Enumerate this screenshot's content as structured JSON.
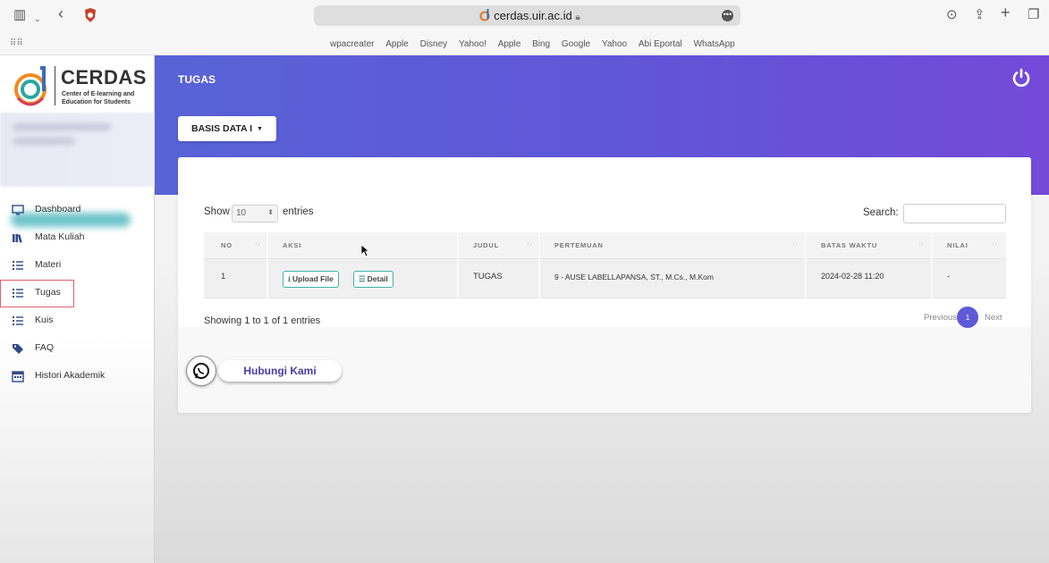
{
  "browser": {
    "url": "cerdas.uir.ac.id",
    "bookmarks": [
      "wpacreater",
      "Apple",
      "Disney",
      "Yahoo!",
      "Apple",
      "Bing",
      "Google",
      "Yahoo",
      "Abi Eportal",
      "WhatsApp"
    ]
  },
  "logo": {
    "title": "CERDAS",
    "subtitle": "Center of E-learning and Education for Students"
  },
  "sidebar": {
    "items": [
      {
        "label": "Dashboard",
        "icon": "monitor-icon"
      },
      {
        "label": "Mata Kuliah",
        "icon": "books-icon"
      },
      {
        "label": "Materi",
        "icon": "list-icon"
      },
      {
        "label": "Tugas",
        "icon": "list-icon",
        "active": true
      },
      {
        "label": "Kuis",
        "icon": "list-icon"
      },
      {
        "label": "FAQ",
        "icon": "tag-icon"
      },
      {
        "label": "Histori Akademik",
        "icon": "calendar-icon"
      }
    ]
  },
  "header": {
    "title": "TUGAS"
  },
  "course_selector": {
    "label": "BASIS DATA I"
  },
  "table_controls": {
    "show_label": "Show",
    "entries_value": "10",
    "entries_label": "entries",
    "search_label": "Search:"
  },
  "table": {
    "columns": [
      "NO",
      "AKSI",
      "JUDUL",
      "PERTEMUAN",
      "BATAS WAKTU",
      "NILAI"
    ],
    "rows": [
      {
        "no": "1",
        "upload_label": "Upload File",
        "detail_label": "Detail",
        "judul": "TUGAS",
        "pertemuan": "9 - AUSE LABELLAPANSA, ST., M.Cs., M.Kom",
        "batas_waktu": "2024-02-28 11:20",
        "nilai": "-"
      }
    ]
  },
  "pagination": {
    "info": "Showing 1 to 1 of 1 entries",
    "previous": "Previous",
    "current": "1",
    "next": "Next"
  },
  "contact": {
    "label": "Hubungi Kami"
  },
  "colors": {
    "primary": "#5e5ad8",
    "accent": "#3bb3a8",
    "active_border": "#e06070"
  }
}
